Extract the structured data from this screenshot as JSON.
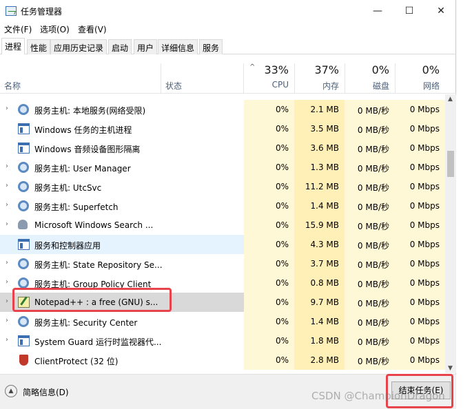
{
  "window": {
    "title": "任务管理器",
    "controls": {
      "minimize": "—",
      "maximize": "☐",
      "close": "✕"
    }
  },
  "menu": [
    "文件(F)",
    "选项(O)",
    "查看(V)"
  ],
  "tabs": [
    "进程",
    "性能",
    "应用历史记录",
    "启动",
    "用户",
    "详细信息",
    "服务"
  ],
  "active_tab": "进程",
  "columns": {
    "name": "名称",
    "status": "状态",
    "cpu": {
      "pct": "33%",
      "label": "CPU"
    },
    "memory": {
      "pct": "37%",
      "label": "内存"
    },
    "disk": {
      "pct": "0%",
      "label": "磁盘"
    },
    "network": {
      "pct": "0%",
      "label": "网络"
    }
  },
  "rows": [
    {
      "expandable": true,
      "icon": "gear-icon",
      "name": "服务主机: 本地服务(网络受限)",
      "cpu": "0%",
      "mem": "2.1 MB",
      "disk": "0 MB/秒",
      "net": "0 Mbps"
    },
    {
      "expandable": false,
      "icon": "window-icon",
      "name": "Windows 任务的主机进程",
      "cpu": "0%",
      "mem": "3.5 MB",
      "disk": "0 MB/秒",
      "net": "0 Mbps"
    },
    {
      "expandable": false,
      "icon": "window-icon",
      "name": "Windows 音频设备图形隔离",
      "cpu": "0%",
      "mem": "3.6 MB",
      "disk": "0 MB/秒",
      "net": "0 Mbps"
    },
    {
      "expandable": true,
      "icon": "gear-icon",
      "name": "服务主机: User Manager",
      "cpu": "0%",
      "mem": "1.3 MB",
      "disk": "0 MB/秒",
      "net": "0 Mbps"
    },
    {
      "expandable": true,
      "icon": "gear-icon",
      "name": "服务主机: UtcSvc",
      "cpu": "0%",
      "mem": "11.2 MB",
      "disk": "0 MB/秒",
      "net": "0 Mbps"
    },
    {
      "expandable": true,
      "icon": "gear-icon",
      "name": "服务主机: Superfetch",
      "cpu": "0%",
      "mem": "1.4 MB",
      "disk": "0 MB/秒",
      "net": "0 Mbps"
    },
    {
      "expandable": true,
      "icon": "person-icon",
      "name": "Microsoft Windows Search ...",
      "cpu": "0%",
      "mem": "15.9 MB",
      "disk": "0 MB/秒",
      "net": "0 Mbps"
    },
    {
      "expandable": false,
      "icon": "window-icon",
      "name": "服务和控制器应用",
      "cpu": "0%",
      "mem": "4.3 MB",
      "disk": "0 MB/秒",
      "net": "0 Mbps"
    },
    {
      "expandable": true,
      "icon": "gear-icon",
      "name": "服务主机: State Repository Se...",
      "cpu": "0%",
      "mem": "3.7 MB",
      "disk": "0 MB/秒",
      "net": "0 Mbps"
    },
    {
      "expandable": true,
      "icon": "gear-icon",
      "name": "服务主机: Group Policy Client",
      "cpu": "0%",
      "mem": "0.8 MB",
      "disk": "0 MB/秒",
      "net": "0 Mbps"
    },
    {
      "expandable": true,
      "icon": "notepad-icon",
      "name": "Notepad++ : a free (GNU) s...",
      "cpu": "0%",
      "mem": "9.7 MB",
      "disk": "0 MB/秒",
      "net": "0 Mbps"
    },
    {
      "expandable": true,
      "icon": "gear-icon",
      "name": "服务主机: Security Center",
      "cpu": "0%",
      "mem": "1.4 MB",
      "disk": "0 MB/秒",
      "net": "0 Mbps"
    },
    {
      "expandable": true,
      "icon": "window-icon",
      "name": "System Guard 运行时监视器代...",
      "cpu": "0%",
      "mem": "1.8 MB",
      "disk": "0 MB/秒",
      "net": "0 Mbps"
    },
    {
      "expandable": false,
      "icon": "shield-icon",
      "name": "ClientProtect (32 位)",
      "cpu": "0%",
      "mem": "2.8 MB",
      "disk": "0 MB/秒",
      "net": "0 Mbps"
    }
  ],
  "selected_row": "Notepad++ : a free (GNU) s...",
  "hover_row": "服务和控制器应用",
  "footer": {
    "fewer_details": "简略信息(D)",
    "end_task": "结束任务(E)"
  },
  "watermark": "CSDN @ChampionDragon",
  "colors": {
    "annotation": "#e8434b",
    "cpu_heat": "#fff8d6",
    "mem_heat": "#fff0b8",
    "selected": "#d9d9d9",
    "hover": "#e5f3ff"
  }
}
